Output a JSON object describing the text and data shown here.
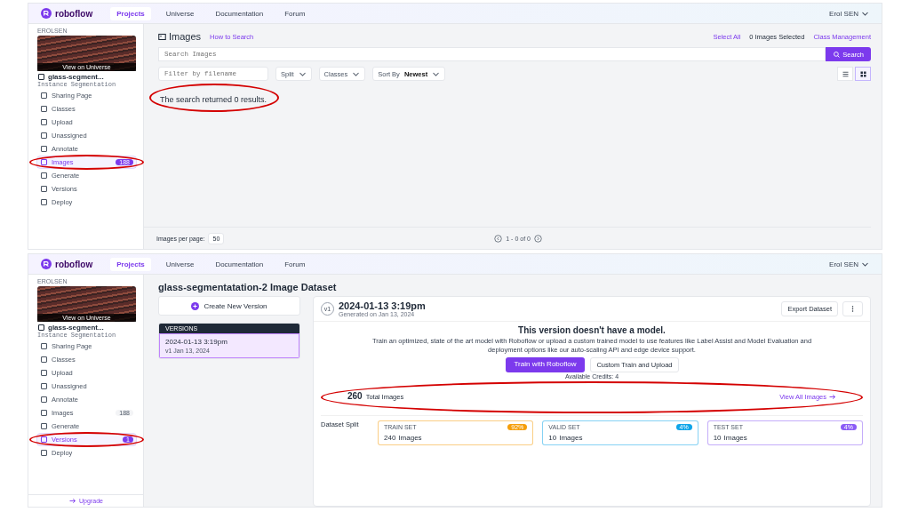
{
  "panels": [
    {
      "kind": "images",
      "nav": {
        "logo": "roboflow",
        "tabs": [
          {
            "label": "Projects",
            "selected": true
          },
          {
            "label": "Universe",
            "selected": false
          },
          {
            "label": "Documentation",
            "selected": false
          },
          {
            "label": "Forum",
            "selected": false
          }
        ],
        "user": "Erol SEN"
      },
      "sidebar": {
        "workspace": "EROLSEN",
        "thumbnail_caption": "View on Universe",
        "project": "glass-segment...",
        "project_type": "Instance Segmentation",
        "items": [
          {
            "label": "Sharing Page",
            "selected": false,
            "annotated": false
          },
          {
            "label": "Classes",
            "selected": false,
            "annotated": false
          },
          {
            "label": "Upload",
            "selected": false,
            "annotated": false
          },
          {
            "label": "Unassigned",
            "selected": false,
            "annotated": false
          },
          {
            "label": "Annotate",
            "selected": false,
            "annotated": false
          },
          {
            "label": "Images",
            "badge": "188",
            "selected": true,
            "annotated": true
          },
          {
            "label": "Generate",
            "selected": false,
            "annotated": false
          },
          {
            "label": "Versions",
            "selected": false,
            "annotated": false
          },
          {
            "label": "Deploy",
            "selected": false,
            "annotated": false
          }
        ]
      },
      "images": {
        "title": "Images",
        "help_link": "How to Search",
        "select_all": "Select All",
        "selected_count": "0 Images Selected",
        "class_link": "Class Management",
        "search_placeholder": "Search Images",
        "search_button": "Search",
        "filter_placeholder": "Filter by filename",
        "dropdowns": [
          {
            "label": "Split"
          },
          {
            "label": "Classes"
          },
          {
            "label": "Sort By",
            "value": "Newest"
          }
        ],
        "message": {
          "text": "The search returned 0 results.",
          "annotated": true
        },
        "per_page_label": "Images per page:",
        "per_page": "50",
        "pagination": "1 - 0 of 0"
      }
    },
    {
      "kind": "versions",
      "nav": {
        "logo": "roboflow",
        "tabs": [
          {
            "label": "Projects",
            "selected": true
          },
          {
            "label": "Universe",
            "selected": false
          },
          {
            "label": "Documentation",
            "selected": false
          },
          {
            "label": "Forum",
            "selected": false
          }
        ],
        "user": "Erol SEN"
      },
      "sidebar": {
        "workspace": "EROLSEN",
        "thumbnail_caption": "View on Universe",
        "project": "glass-segment...",
        "project_type": "Instance Segmentation",
        "items": [
          {
            "label": "Sharing Page",
            "selected": false,
            "annotated": false
          },
          {
            "label": "Classes",
            "selected": false,
            "annotated": false
          },
          {
            "label": "Upload",
            "selected": false,
            "annotated": false
          },
          {
            "label": "Unassigned",
            "selected": false,
            "annotated": false
          },
          {
            "label": "Annotate",
            "selected": false,
            "annotated": false
          },
          {
            "label": "Images",
            "badge": "188",
            "selected": false,
            "annotated": false
          },
          {
            "label": "Generate",
            "selected": false,
            "annotated": false
          },
          {
            "label": "Versions",
            "badge": "1",
            "selected": true,
            "annotated": true
          },
          {
            "label": "Deploy",
            "selected": false,
            "annotated": false
          }
        ],
        "upgrade": "Upgrade"
      },
      "versions": {
        "title": "glass-segmentatation-2 Image Dataset",
        "create_button": "Create New Version",
        "list_heading": "VERSIONS",
        "list": [
          {
            "title": "2024-01-13 3:19pm",
            "subtitle": "v1 Jan 13, 2024",
            "selected": true
          }
        ],
        "detail": {
          "tag": "v1",
          "heading": "2024-01-13 3:19pm",
          "generated": "Generated on Jan 13, 2024",
          "export_button": "Export Dataset",
          "model_heading": "This version doesn't have a model.",
          "model_text": "Train an optimized, state of the art model with Roboflow or upload a custom trained model to use features like Label Assist and Model Evaluation and deployment options like our auto-scaling API and edge device support.",
          "train_button": "Train with Roboflow",
          "custom_button": "Custom Train and Upload",
          "credits": "Available Credits: 4",
          "total": {
            "count": "260",
            "label": "Total Images",
            "link": "View All Images",
            "annotated": true
          },
          "split_label": "Dataset Split",
          "splits": [
            {
              "name": "TRAIN SET",
              "percent": "92%",
              "count": "240",
              "unit": "Images",
              "color": "#f59e0b"
            },
            {
              "name": "VALID SET",
              "percent": "4%",
              "count": "10",
              "unit": "Images",
              "color": "#0ea5e9"
            },
            {
              "name": "TEST SET",
              "percent": "4%",
              "count": "10",
              "unit": "Images",
              "color": "#8b5cf6"
            }
          ]
        }
      }
    }
  ]
}
